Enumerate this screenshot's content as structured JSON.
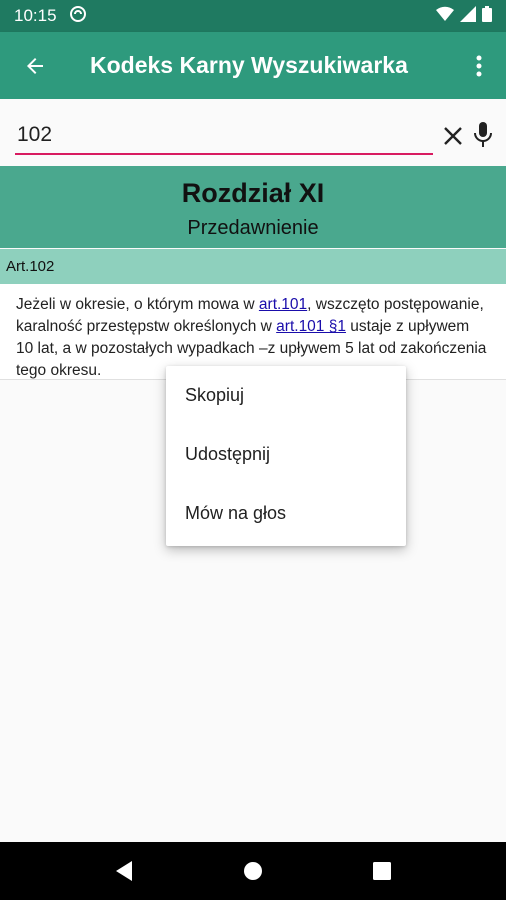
{
  "status_bar": {
    "time": "10:15"
  },
  "app_bar": {
    "title": "Kodeks Karny Wyszukiwarka"
  },
  "search": {
    "value": "102"
  },
  "chapter": {
    "title": "Rozdział XI",
    "subtitle": "Przedawnienie"
  },
  "article": {
    "header": "Art.102",
    "text_1": "Jeżeli w okresie, o którym mowa w ",
    "link_1": "art.101",
    "text_2": ", wszczęto postępowanie, karalność przestępstw określonych w ",
    "link_2": "art.101 §1",
    "text_3": " ustaje z upływem 10 lat, a w pozostałych wypadkach –z upływem 5 lat od zakończenia tego okresu."
  },
  "context_menu": {
    "items": [
      {
        "label": "Skopiuj"
      },
      {
        "label": "Udostępnij"
      },
      {
        "label": "Mów na głos"
      }
    ]
  },
  "colors": {
    "status_bar": "#1f7a61",
    "app_bar": "#2e9a7d",
    "chapter_bg": "#4aa88e",
    "article_header_bg": "#8ed0bd",
    "search_underline": "#d81b60"
  }
}
